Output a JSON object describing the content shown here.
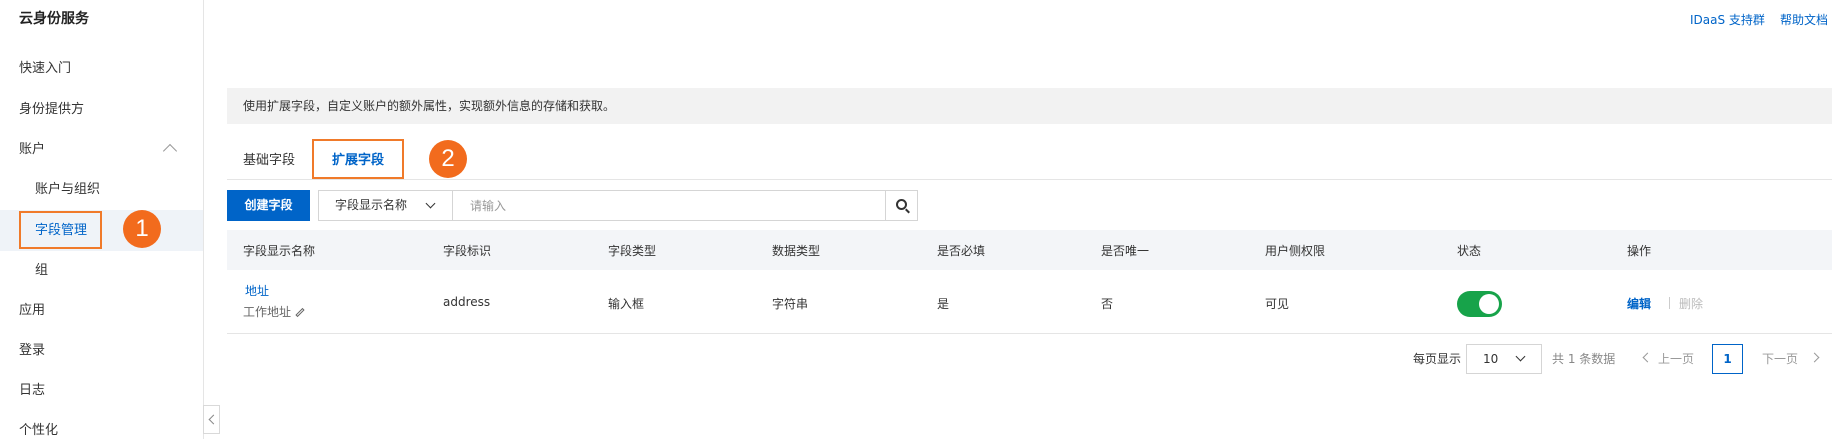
{
  "sidebar": {
    "title": "云身份服务",
    "items": {
      "quickstart": "快速入门",
      "idp": "身份提供方",
      "account": "账户",
      "account_org": "账户与组织",
      "field_mgmt": "字段管理",
      "group": "组",
      "apps": "应用",
      "login": "登录",
      "logs": "日志",
      "personalize": "个性化"
    }
  },
  "header": {
    "support_group": "IDaaS 支持群",
    "help_docs": "帮助文档"
  },
  "notice": "使用扩展字段，自定义账户的额外属性，实现额外信息的存储和获取。",
  "tabs": {
    "basic": "基础字段",
    "extended": "扩展字段"
  },
  "annotations": {
    "step1": "1",
    "step2": "2"
  },
  "toolbar": {
    "create_button": "创建字段",
    "filter_select": "字段显示名称",
    "search_placeholder": "请输入"
  },
  "table": {
    "headers": {
      "display_name": "字段显示名称",
      "field_id": "字段标识",
      "field_type": "字段类型",
      "data_type": "数据类型",
      "required": "是否必填",
      "unique": "是否唯一",
      "user_permission": "用户侧权限",
      "status": "状态",
      "actions": "操作"
    },
    "rows": [
      {
        "name": "地址",
        "description": "工作地址",
        "field_id": "address",
        "field_type": "输入框",
        "data_type": "字符串",
        "required": "是",
        "unique": "否",
        "user_permission": "可见",
        "status_enabled": true,
        "edit": "编辑",
        "delete": "删除"
      }
    ]
  },
  "pagination": {
    "per_page_label": "每页显示",
    "per_page_value": "10",
    "total": "共 1 条数据",
    "prev": "上一页",
    "current_page": "1",
    "next": "下一页"
  },
  "colors": {
    "primary": "#0064c8",
    "highlight_orange": "#f26b1d",
    "toggle_on": "#17a34a"
  }
}
